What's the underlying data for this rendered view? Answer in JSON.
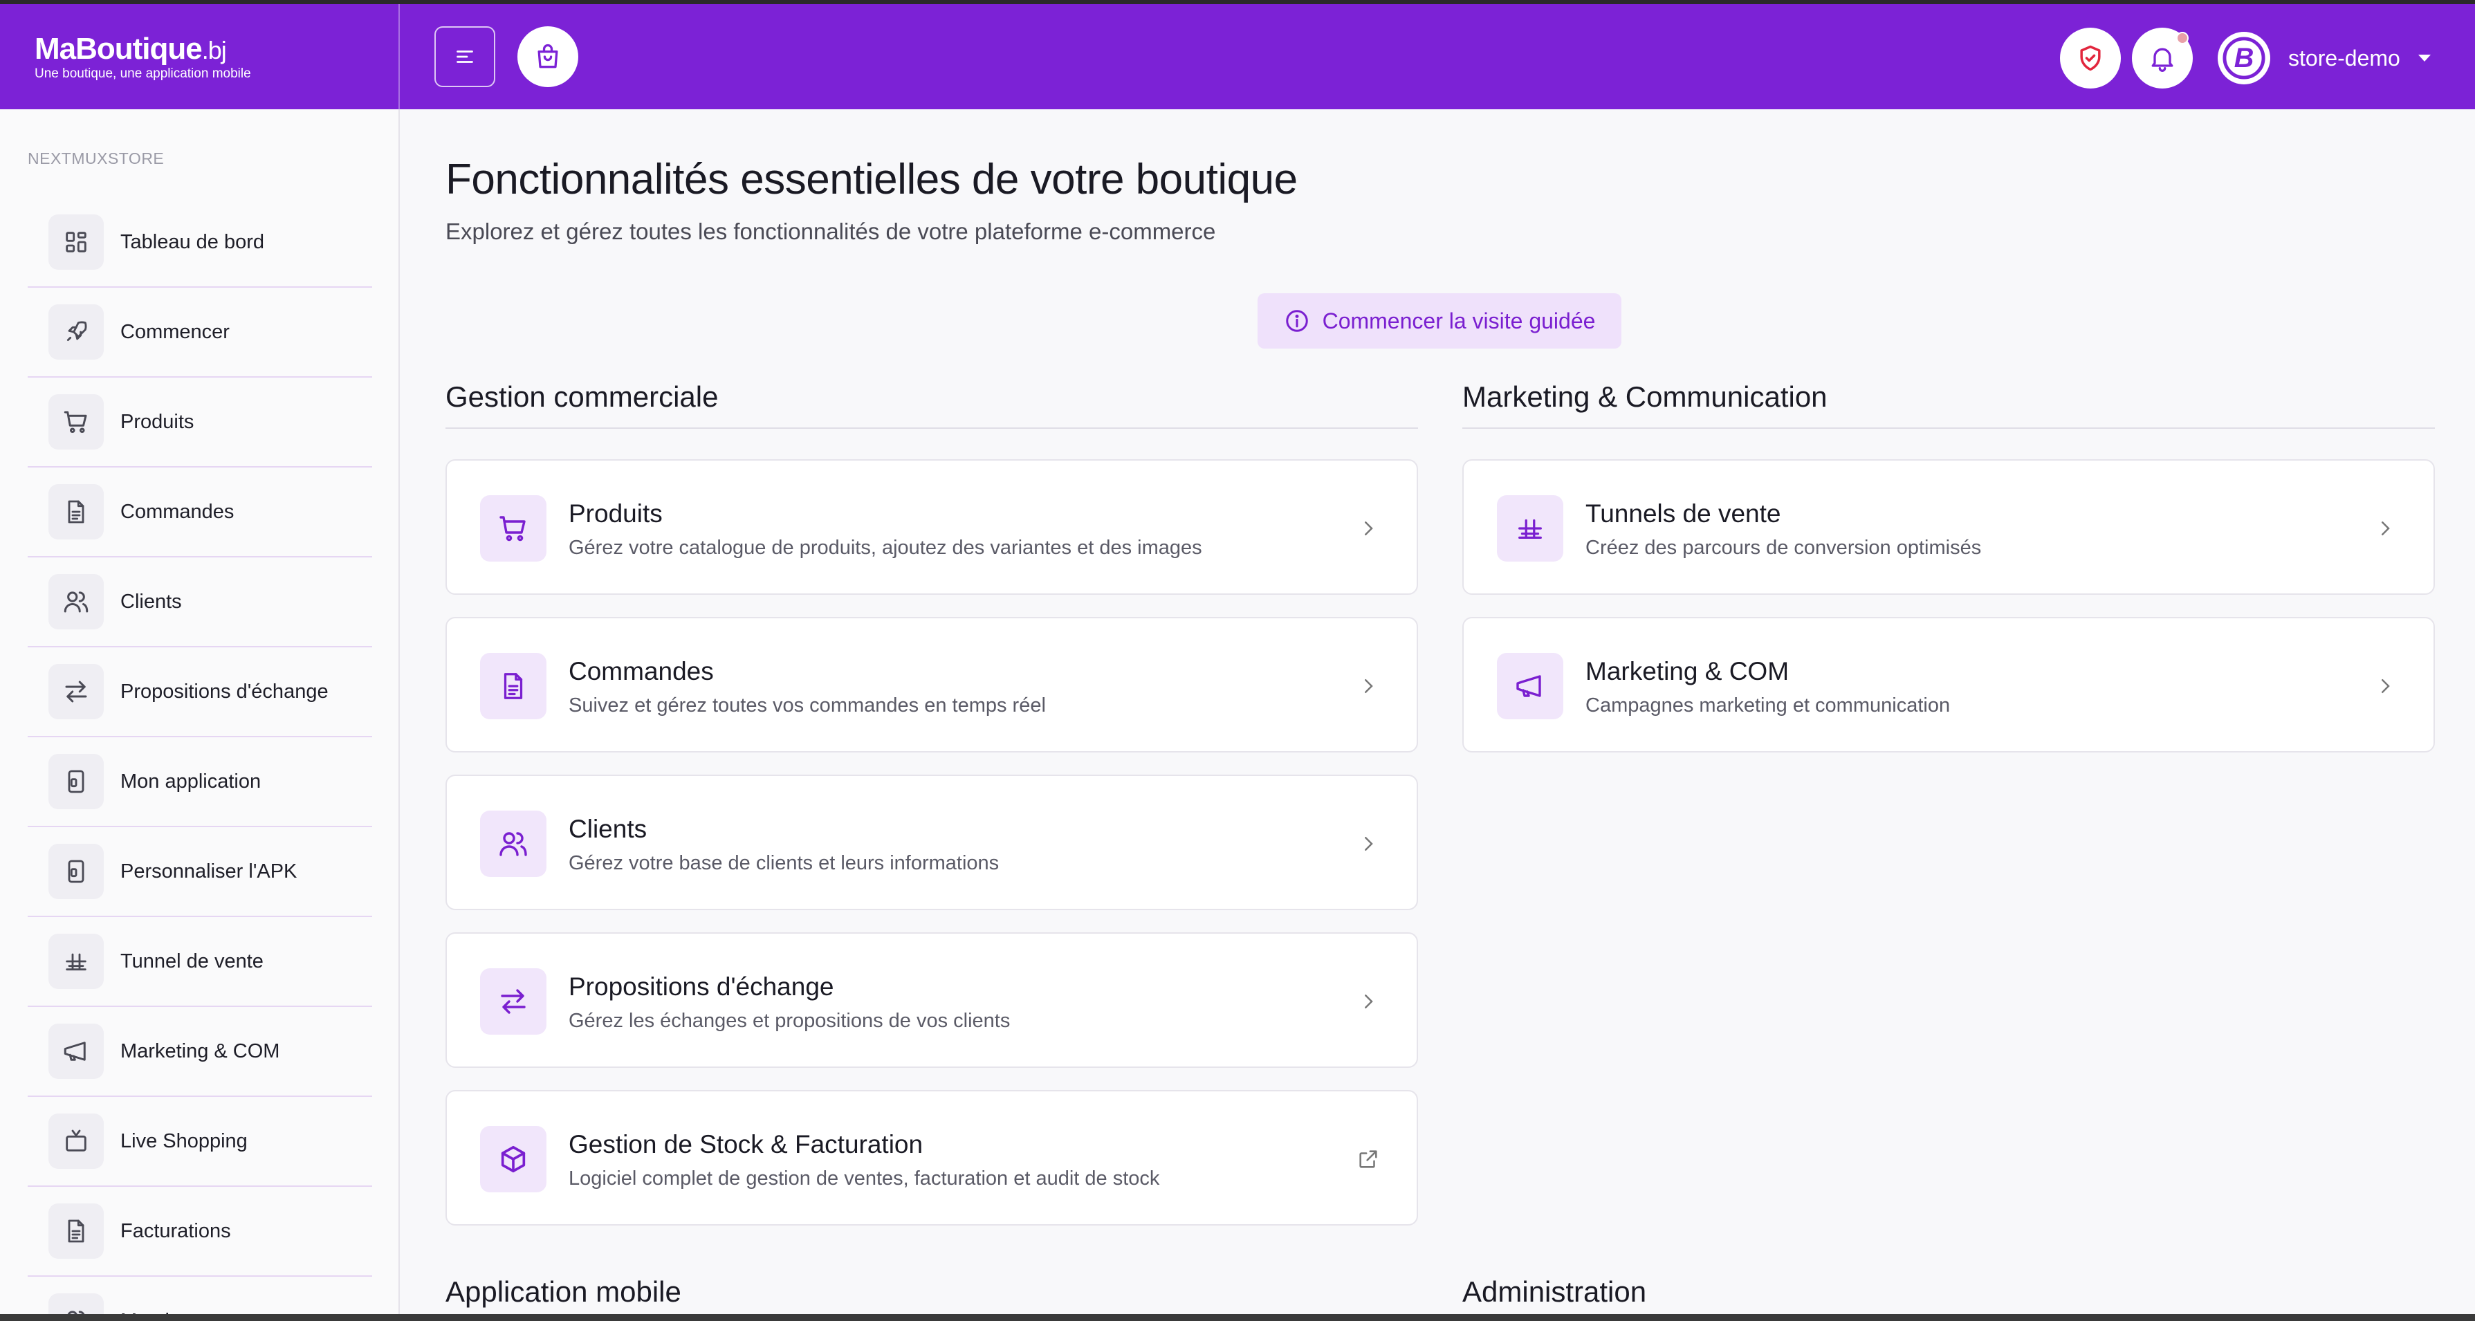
{
  "brand": {
    "logo_main": "MaBoutique",
    "logo_suffix": ".bj",
    "tagline": "Une boutique, une application mobile"
  },
  "header": {
    "user_name": "store-demo"
  },
  "sidebar": {
    "store_label": "NEXTMUXSTORE",
    "items": [
      {
        "label": "Tableau de bord",
        "icon": "dashboard-icon"
      },
      {
        "label": "Commencer",
        "icon": "rocket-icon"
      },
      {
        "label": "Produits",
        "icon": "cart-icon"
      },
      {
        "label": "Commandes",
        "icon": "document-icon"
      },
      {
        "label": "Clients",
        "icon": "users-icon"
      },
      {
        "label": "Propositions d'échange",
        "icon": "exchange-icon"
      },
      {
        "label": "Mon application",
        "icon": "mobile-icon"
      },
      {
        "label": "Personnaliser l'APK",
        "icon": "mobile-icon"
      },
      {
        "label": "Tunnel de vente",
        "icon": "funnel-icon"
      },
      {
        "label": "Marketing & COM",
        "icon": "megaphone-icon"
      },
      {
        "label": "Live Shopping",
        "icon": "tv-icon"
      },
      {
        "label": "Facturations",
        "icon": "document-icon"
      },
      {
        "label": "Membres",
        "icon": "users-icon"
      }
    ]
  },
  "main": {
    "title": "Fonctionnalités essentielles de votre boutique",
    "subtitle": "Explorez et gérez toutes les fonctionnalités de votre plateforme e-commerce",
    "tour_button": "Commencer la visite guidée",
    "sections": {
      "commercial": {
        "title": "Gestion commerciale",
        "cards": [
          {
            "title": "Produits",
            "desc": "Gérez votre catalogue de produits, ajoutez des variantes et des images"
          },
          {
            "title": "Commandes",
            "desc": "Suivez et gérez toutes vos commandes en temps réel"
          },
          {
            "title": "Clients",
            "desc": "Gérez votre base de clients et leurs informations"
          },
          {
            "title": "Propositions d'échange",
            "desc": "Gérez les échanges et propositions de vos clients"
          },
          {
            "title": "Gestion de Stock & Facturation",
            "desc": "Logiciel complet de gestion de ventes, facturation et audit de stock"
          }
        ]
      },
      "marketing": {
        "title": "Marketing & Communication",
        "cards": [
          {
            "title": "Tunnels de vente",
            "desc": "Créez des parcours de conversion optimisés"
          },
          {
            "title": "Marketing & COM",
            "desc": "Campagnes marketing et communication"
          }
        ]
      },
      "mobile": {
        "title": "Application mobile"
      },
      "admin": {
        "title": "Administration"
      }
    }
  },
  "colors": {
    "brand_purple": "#7c22d6",
    "icon_bg": "#f1e6fb",
    "accent": "#7a1fd0"
  }
}
